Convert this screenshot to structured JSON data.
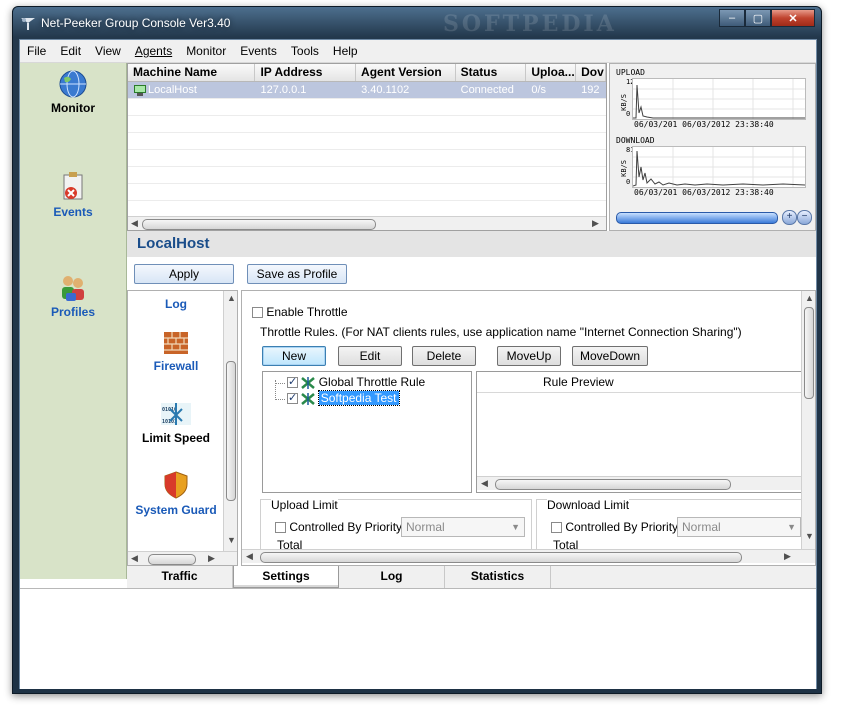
{
  "window": {
    "title": "Net-Peeker Group Console Ver3.40",
    "watermark": "SOFTPEDIA",
    "controls": {
      "minimize": "‒",
      "maximize": "▢",
      "close": "✕"
    }
  },
  "menu": [
    "File",
    "Edit",
    "View",
    "Agents",
    "Monitor",
    "Events",
    "Tools",
    "Help"
  ],
  "sidebar": [
    {
      "label": "Monitor",
      "icon": "globe-icon",
      "active": true
    },
    {
      "label": "Events",
      "icon": "clipboard-icon",
      "active": false
    },
    {
      "label": "Profiles",
      "icon": "users-icon",
      "active": false
    }
  ],
  "machines": {
    "columns": [
      "Machine Name",
      "IP Address",
      "Agent Version",
      "Status",
      "Uploa...",
      "Dov"
    ],
    "rows": [
      [
        "LocalHost",
        "127.0.0.1",
        "3.40.1102",
        "Connected",
        "0/s",
        "192"
      ]
    ]
  },
  "graphs": {
    "upload": {
      "title": "UPLOAD",
      "axis": "KB/S",
      "max": "12",
      "zero": "0",
      "time": "06/03/201 06/03/2012  23:38:40"
    },
    "download": {
      "title": "DOWNLOAD",
      "axis": "KB/S",
      "max": "81",
      "zero": "0",
      "time": "06/03/201 06/03/2012  23:38:40"
    },
    "zoom_in": "+",
    "zoom_out": "−"
  },
  "host": {
    "name": "LocalHost"
  },
  "toolbar": {
    "apply": "Apply",
    "save_profile": "Save as Profile"
  },
  "tools_list": [
    {
      "label": "Log",
      "icon": "log-icon"
    },
    {
      "label": "Firewall",
      "icon": "firewall-icon"
    },
    {
      "label": "Limit Speed",
      "icon": "speed-icon",
      "active": true
    },
    {
      "label": "System Guard",
      "icon": "shield-icon"
    }
  ],
  "throttle": {
    "enable_label": "Enable Throttle",
    "rules_caption": "Throttle Rules. (For NAT clients rules, use application name \"Internet Connection Sharing\")",
    "buttons": [
      "New",
      "Edit",
      "Delete",
      "MoveUp",
      "MoveDown"
    ],
    "rules": [
      {
        "name": "Global Throttle Rule",
        "checked": true,
        "selected": false
      },
      {
        "name": "Softpedia Test",
        "checked": true,
        "selected": true
      }
    ],
    "preview_header": "Rule Preview",
    "upload": {
      "title": "Upload Limit",
      "priority_label": "Controlled By Priority",
      "priority_value": "Normal",
      "total_label": "Total"
    },
    "download": {
      "title": "Download Limit",
      "priority_label": "Controlled By Priority",
      "priority_value": "Normal",
      "total_label": "Total"
    }
  },
  "tabs": [
    "Traffic",
    "Settings",
    "Log",
    "Statistics"
  ],
  "active_tab": "Settings",
  "colors": {
    "sidebar_bg": "#d8e3c8",
    "host_title": "#1a4d8a",
    "selected_row": "#bcc6de",
    "tool_link": "#1a5ab8"
  }
}
